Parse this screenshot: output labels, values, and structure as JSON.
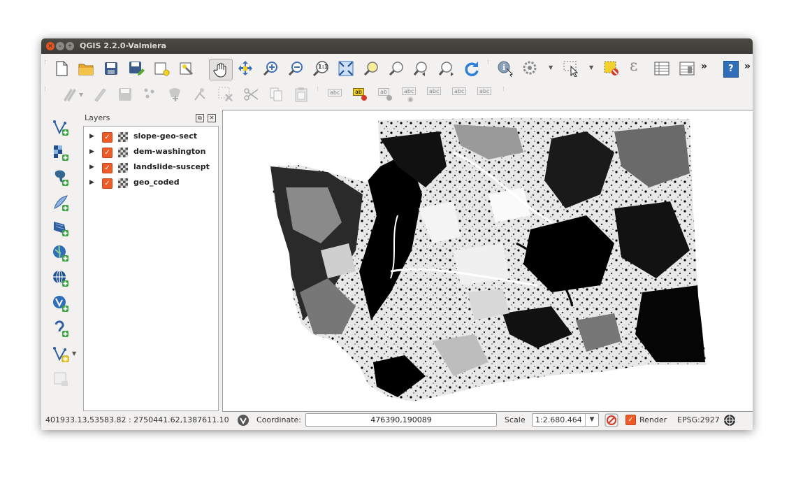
{
  "window": {
    "title": "QGIS 2.2.0-Valmiera"
  },
  "toolbar": {
    "overflow_glyph": "»",
    "abc": "abc",
    "ab": "ab",
    "zoom_native": "1:1",
    "epsilon": "ε",
    "help_glyph": "?"
  },
  "layers_panel": {
    "title": "Layers",
    "float_glyph": "⧉",
    "close_glyph": "✕",
    "layers": [
      {
        "name": "slope-geo-sect",
        "checked": true
      },
      {
        "name": "dem-washington",
        "checked": true
      },
      {
        "name": "landslide-suscept",
        "checked": true
      },
      {
        "name": "geo_coded",
        "checked": true
      }
    ]
  },
  "glyphs": {
    "expand": "▶",
    "check": "✓",
    "dropdown": "▼"
  },
  "status": {
    "extent": "401933.13,53583.82 : 2750441.62,1387611.10",
    "coordinate_label": "Coordinate:",
    "coordinate_value": "476390,190089",
    "scale_label": "Scale",
    "scale_value": "1:2.680.464",
    "render_label": "Render",
    "crs": "EPSG:2927"
  }
}
